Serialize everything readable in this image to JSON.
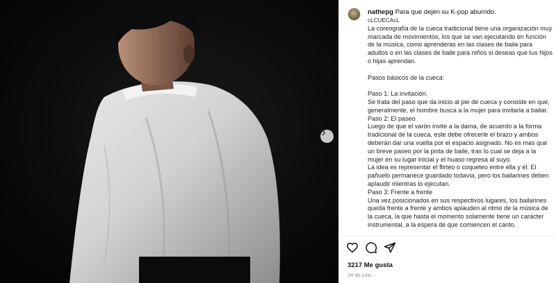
{
  "post": {
    "username": "nathepg",
    "caption_title": "Para que dejen su K-pop aburrido.",
    "source_tag": "cLCUECAcL",
    "paragraphs": [
      "La coreografía de la cueca tradicional tiene una organización muy marcada de movimientos, los que se van ejecutando en función de la música, como aprenderás en las clases de baila para adultos o en las clases de baile para niños si deseas que tus hijos o hijas aprendan.",
      "",
      "Pasos básicos de la cueca:",
      "",
      "Paso 1: La invitación.",
      "Se trata del paso que da inicio al pie de cueca y consiste en que, generalmente, el hombre busca a la mujer para invitarla a bailar.",
      "Paso 2: El paseo",
      "Luego de que el varón invite a la dama, de acuerdo a la forma tradicional de la cueca, este debe ofrecerle el brazo y ambos deberán dar una vuelta por el espacio asignado. No es mas que un breve paseo por la pista de baile, tras lo cual se deja a la mujer en su lugar inicial y el huaso regresa al suyo.",
      "La idea es representar el flirteo o coqueteo entre ella y él. El pañuelo permanece guardado todavía, pero los bailarines deben aplaudir mientras lo ejecutan.",
      "Paso 3: Frente a frente",
      "Una vez posicionados en sus respectivos lugares, los bailarines queda frente a frente y ambos aplauden al ritmo de la música de la cueca, la que hasta el momento solamente tiene un carácter instrumental, a la espera de que comiencen el canto."
    ],
    "likes": "3217 Me gusta",
    "date": "24 de julio"
  },
  "icons": {
    "like": "heart-icon",
    "comment": "comment-icon",
    "share": "send-icon",
    "next": "chevron-right-icon"
  }
}
